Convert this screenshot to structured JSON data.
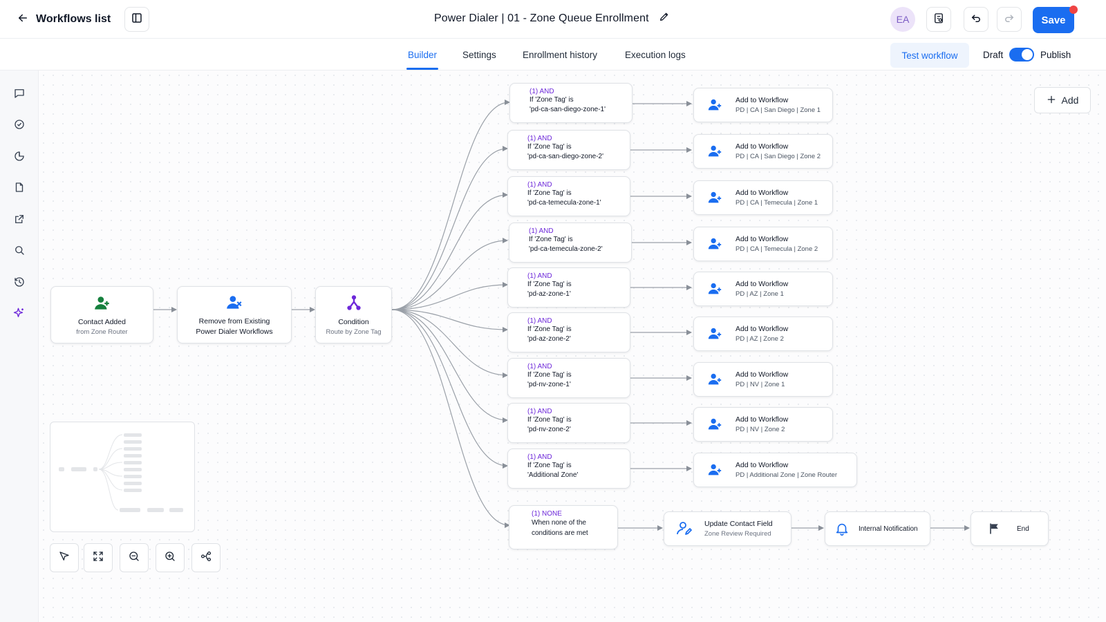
{
  "header": {
    "back_label": "Workflows list",
    "title": "Power Dialer | 01 - Zone Queue Enrollment",
    "avatar_initials": "EA",
    "save_label": "Save"
  },
  "tabs": [
    {
      "label": "Builder",
      "active": true
    },
    {
      "label": "Settings",
      "active": false
    },
    {
      "label": "Enrollment history",
      "active": false
    },
    {
      "label": "Execution logs",
      "active": false
    }
  ],
  "controls": {
    "test_label": "Test workflow",
    "draft_label": "Draft",
    "publish_label": "Publish",
    "publish_toggle_on": true
  },
  "sidebar": {
    "icons": [
      "chat-icon",
      "check-circle-icon",
      "pie-chart-icon",
      "document-icon",
      "external-link-icon",
      "search-icon",
      "history-icon",
      "sparkles-icon"
    ]
  },
  "canvas": {
    "add_label": "Add",
    "trigger": {
      "title": "Contact Added",
      "subtitle": "from Zone Router"
    },
    "remove": {
      "title_line1": "Remove from Existing",
      "title_line2": "Power Dialer Workflows"
    },
    "condition": {
      "title": "Condition",
      "subtitle": "Route by Zone Tag"
    },
    "branches": [
      {
        "tag": "(1) AND",
        "line1": "If 'Zone Tag' is",
        "line2": "'pd-ca-san-diego-zone-1'",
        "action_title": "Add to Workflow",
        "action_sub": "PD | CA | San Diego | Zone 1"
      },
      {
        "tag": "(1) AND",
        "line1": "If 'Zone Tag' is",
        "line2": "'pd-ca-san-diego-zone-2'",
        "action_title": "Add to Workflow",
        "action_sub": "PD | CA | San Diego | Zone 2"
      },
      {
        "tag": "(1) AND",
        "line1": "If 'Zone Tag' is",
        "line2": "'pd-ca-temecula-zone-1'",
        "action_title": "Add to Workflow",
        "action_sub": "PD | CA | Temecula | Zone 1"
      },
      {
        "tag": "(1) AND",
        "line1": "If 'Zone Tag' is",
        "line2": "'pd-ca-temecula-zone-2'",
        "action_title": "Add to Workflow",
        "action_sub": "PD | CA | Temecula | Zone 2"
      },
      {
        "tag": "(1) AND",
        "line1": "If 'Zone Tag' is",
        "line2": "'pd-az-zone-1'",
        "action_title": "Add to Workflow",
        "action_sub": "PD | AZ | Zone 1"
      },
      {
        "tag": "(1) AND",
        "line1": "If 'Zone Tag' is",
        "line2": "'pd-az-zone-2'",
        "action_title": "Add to Workflow",
        "action_sub": "PD | AZ | Zone 2"
      },
      {
        "tag": "(1) AND",
        "line1": "If 'Zone Tag' is",
        "line2": "'pd-nv-zone-1'",
        "action_title": "Add to Workflow",
        "action_sub": "PD | NV | Zone 1"
      },
      {
        "tag": "(1) AND",
        "line1": "If 'Zone Tag' is",
        "line2": "'pd-nv-zone-2'",
        "action_title": "Add to Workflow",
        "action_sub": "PD | NV | Zone 2"
      },
      {
        "tag": "(1) AND",
        "line1": "If 'Zone Tag' is",
        "line2": "'Additional Zone'",
        "action_title": "Add to Workflow",
        "action_sub": "PD | Additional Zone | Zone Router"
      }
    ],
    "none_branch": {
      "tag": "(1) NONE",
      "line1": "When none of the",
      "line2": "conditions are met"
    },
    "update_field": {
      "title": "Update Contact Field",
      "subtitle": "Zone Review Required"
    },
    "notification": {
      "title": "Internal Notification"
    },
    "end": {
      "title": "End"
    }
  },
  "toolbar": {
    "tools": [
      "cursor-icon",
      "fit-view-icon",
      "zoom-out-icon",
      "zoom-in-icon",
      "auto-layout-icon"
    ]
  }
}
